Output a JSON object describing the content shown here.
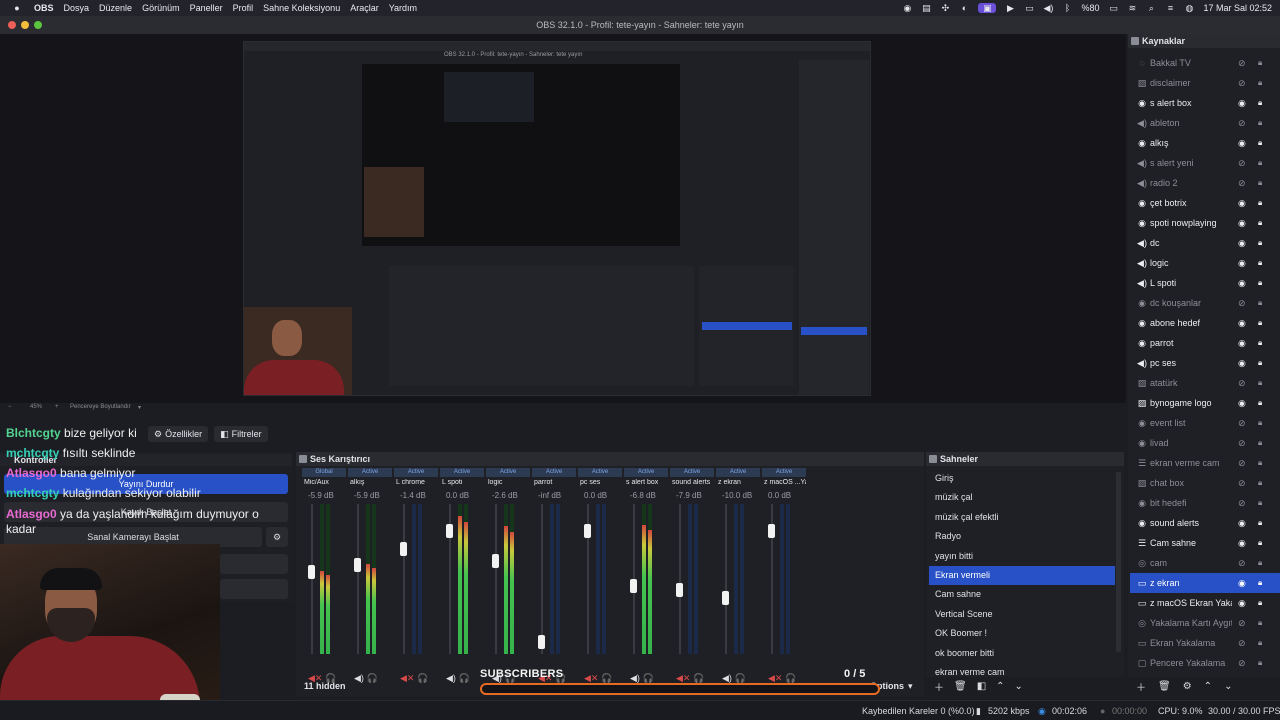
{
  "menubar": {
    "app": "OBS",
    "items": [
      "Dosya",
      "Düzenle",
      "Görünüm",
      "Paneller",
      "Profil",
      "Sahne Koleksiyonu",
      "Araçlar",
      "Yardım"
    ],
    "battery": "%80",
    "datetime": "17 Mar Sal  02:52"
  },
  "window": {
    "title": "OBS 32.1.0 - Profil: tete-yayın - Sahneler: tete yayın"
  },
  "preview": {
    "nested_title": "OBS 32.1.0 - Profil: tete-yayın - Sahneler: tete yayın",
    "zoom": "45%",
    "fit_label": "Pencereye Boyutlandır"
  },
  "source_toolbar": {
    "properties": "Özellikler",
    "filters": "Filtreler"
  },
  "chat": {
    "lines": [
      {
        "nick": "Blchtcgty",
        "text": "bize geliyor ki"
      },
      {
        "nick": "mchtcgty",
        "text": "fısıltı seklinde"
      },
      {
        "nick": "Atlasgo0",
        "text": "bana gelmiyor"
      },
      {
        "nick": "mchtcgty",
        "text": "kulağından sekiyor olabilir"
      },
      {
        "nick": "Atlasgo0",
        "text": "ya da yaşlandım kulağım duymuyor o"
      },
      {
        "nick": "",
        "text": "kadar"
      }
    ]
  },
  "controls": {
    "title": "Kontroller",
    "stop_stream": "Yayını Durdur",
    "start_record": "Kaydı Başlat",
    "virtual_cam": "Sanal Kamerayı Başlat"
  },
  "mixer": {
    "title": "Ses Karıştırıcı",
    "hidden": "11 hidden",
    "options": "Options",
    "channels": [
      {
        "badge": "Global",
        "name": "Mic/Aux",
        "db": "-5.9 dB",
        "level": 0.55,
        "fader": 0.55,
        "muted": true
      },
      {
        "badge": "Active",
        "name": "alkış",
        "db": "-5.9 dB",
        "level": 0.6,
        "fader": 0.6,
        "muted": false
      },
      {
        "badge": "Active",
        "name": "L chrome",
        "db": "-1.4 dB",
        "level": 0.0,
        "fader": 0.72,
        "muted": true
      },
      {
        "badge": "Active",
        "name": "L spoti",
        "db": "0.0 dB",
        "level": 0.92,
        "fader": 0.85,
        "muted": false
      },
      {
        "badge": "Active",
        "name": "logic",
        "db": "-2.6 dB",
        "level": 0.85,
        "fader": 0.63,
        "muted": false
      },
      {
        "badge": "Active",
        "name": "parrot",
        "db": "-inf dB",
        "level": 0.0,
        "fader": 0.04,
        "muted": true
      },
      {
        "badge": "Active",
        "name": "pc ses",
        "db": "0.0 dB",
        "level": 0.0,
        "fader": 0.85,
        "muted": true
      },
      {
        "badge": "Active",
        "name": "s alert box",
        "db": "-6.8 dB",
        "level": 0.86,
        "fader": 0.45,
        "muted": false
      },
      {
        "badge": "Active",
        "name": "sound alerts",
        "db": "-7.9 dB",
        "level": 0.0,
        "fader": 0.42,
        "muted": true
      },
      {
        "badge": "Active",
        "name": "z ekran",
        "db": "-10.0 dB",
        "level": 0.0,
        "fader": 0.36,
        "muted": false
      },
      {
        "badge": "Active",
        "name": "z macOS ...Yakalamı",
        "db": "0.0 dB",
        "level": 0.0,
        "fader": 0.85,
        "muted": true
      }
    ]
  },
  "subscribers": {
    "label": "SUBSCRIBERS",
    "current": "0",
    "goal": "/ 5"
  },
  "scenes": {
    "title": "Sahneler",
    "items": [
      "Giriş",
      "müzik çal",
      "müzik çal efektli",
      "Radyo",
      "yayın bitti",
      "Ekran vermeli",
      "Cam sahne",
      "Vertical Scene",
      "OK Boomer !",
      "ok boomer bitti",
      "ekran verme cam"
    ],
    "selected": 5
  },
  "sources": {
    "title": "Kaynaklar",
    "items": [
      {
        "name": "Bakkal TV",
        "icon": "eye-off",
        "visible": false
      },
      {
        "name": "disclaimer",
        "icon": "image-icon",
        "visible": false
      },
      {
        "name": "s alert box",
        "icon": "globe-icon",
        "visible": true
      },
      {
        "name": "ableton",
        "icon": "audio-icon",
        "visible": false
      },
      {
        "name": "alkış",
        "icon": "globe-icon",
        "visible": true
      },
      {
        "name": "s alert yeni",
        "icon": "audio-icon",
        "visible": false
      },
      {
        "name": "radio 2",
        "icon": "audio-icon",
        "visible": false
      },
      {
        "name": "çet botrix",
        "icon": "globe-icon",
        "visible": true
      },
      {
        "name": "spoti nowplaying",
        "icon": "globe-icon",
        "visible": true
      },
      {
        "name": "dc",
        "icon": "audio-icon",
        "visible": true
      },
      {
        "name": "logic",
        "icon": "audio-icon",
        "visible": true
      },
      {
        "name": "L spoti",
        "icon": "audio-icon",
        "visible": true
      },
      {
        "name": "dc kouşanlar",
        "icon": "globe-icon",
        "visible": false
      },
      {
        "name": "abone hedef",
        "icon": "globe-icon",
        "visible": true
      },
      {
        "name": "parrot",
        "icon": "globe-icon",
        "visible": true
      },
      {
        "name": "pc ses",
        "icon": "audio-icon",
        "visible": true
      },
      {
        "name": "atatürk",
        "icon": "image-icon",
        "visible": false
      },
      {
        "name": "bynogame logo",
        "icon": "image-icon",
        "visible": true
      },
      {
        "name": "event list",
        "icon": "globe-icon",
        "visible": false
      },
      {
        "name": "livad",
        "icon": "globe-icon",
        "visible": false
      },
      {
        "name": "ekran verme cam",
        "icon": "list-icon",
        "visible": false
      },
      {
        "name": "chat box",
        "icon": "image-icon",
        "visible": false
      },
      {
        "name": "bit hedefi",
        "icon": "globe-icon",
        "visible": false
      },
      {
        "name": "sound alerts",
        "icon": "globe-icon",
        "visible": true
      },
      {
        "name": "Cam sahne",
        "icon": "list-icon",
        "visible": true
      },
      {
        "name": "cam",
        "icon": "camera-icon",
        "visible": false
      },
      {
        "name": "z ekran",
        "icon": "monitor-icon",
        "visible": true,
        "selected": true
      },
      {
        "name": "z macOS Ekran Yakalama",
        "icon": "monitor-icon",
        "visible": true
      },
      {
        "name": "Yakalama Kartı Aygıtı",
        "icon": "camera-icon",
        "visible": false
      },
      {
        "name": "Ekran Yakalama",
        "icon": "monitor-icon",
        "visible": false
      },
      {
        "name": "Pencere Yakalama",
        "icon": "window-icon",
        "visible": false
      }
    ]
  },
  "statusbar": {
    "dropped": "Kaybedilen Kareler 0 (%0.0)",
    "bitrate": "5202 kbps",
    "stream_time": "00:02:06",
    "record_time": "00:00:00",
    "cpu": "CPU: 9.0%",
    "fps": "30.00 / 30.00 FPS"
  },
  "colors": {
    "accent": "#2851c8",
    "meter_green": "#44c34f",
    "muted_red": "#d84a4a",
    "subscriber_border": "#e56a22"
  }
}
